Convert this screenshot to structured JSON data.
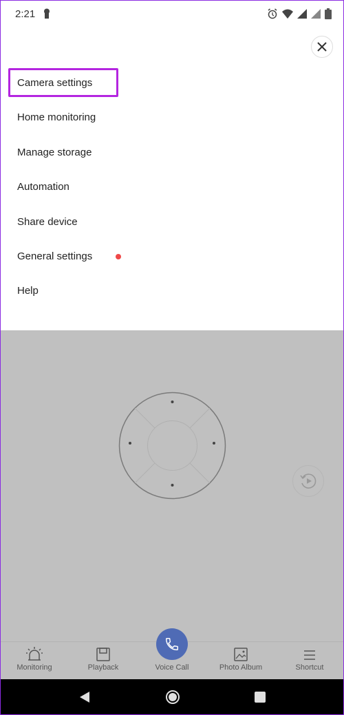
{
  "status_bar": {
    "time": "2:21"
  },
  "menu": {
    "items": [
      {
        "label": "Camera settings",
        "highlighted": true
      },
      {
        "label": "Home monitoring"
      },
      {
        "label": "Manage storage"
      },
      {
        "label": "Automation"
      },
      {
        "label": "Share device"
      },
      {
        "label": "General settings",
        "badge": "red-dot"
      },
      {
        "label": "Help"
      }
    ]
  },
  "tabs": [
    {
      "label": "Monitoring",
      "icon": "alarm-light-icon"
    },
    {
      "label": "Playback",
      "icon": "playback-icon"
    },
    {
      "label": "Voice Call",
      "icon": "phone-icon"
    },
    {
      "label": "Photo Album",
      "icon": "photo-album-icon"
    },
    {
      "label": "Shortcut",
      "icon": "menu-icon"
    }
  ],
  "colors": {
    "highlight_border": "#b425e0",
    "badge": "#ef4848",
    "voice_call": "#4f6bb5",
    "overlay": "#c0c0c0"
  }
}
